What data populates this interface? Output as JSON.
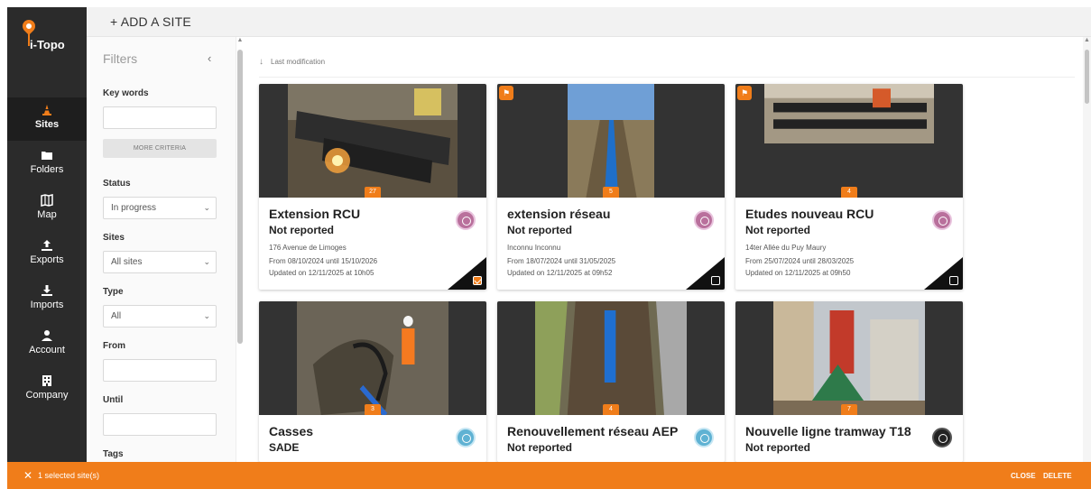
{
  "app": {
    "logo_text": "i-Topo"
  },
  "nav": [
    {
      "label": "Sites",
      "icon": "cone-icon",
      "active": true
    },
    {
      "label": "Folders",
      "icon": "folder-icon"
    },
    {
      "label": "Map",
      "icon": "map-icon"
    },
    {
      "label": "Exports",
      "icon": "upload-icon"
    },
    {
      "label": "Imports",
      "icon": "download-icon"
    },
    {
      "label": "Account",
      "icon": "user-icon"
    },
    {
      "label": "Company",
      "icon": "building-icon"
    }
  ],
  "topbar": {
    "add_site": "+ ADD A SITE"
  },
  "filters": {
    "title": "Filters",
    "keywords_label": "Key words",
    "keywords_value": "",
    "more_criteria": "MORE CRITERIA",
    "status_label": "Status",
    "status_value": "In progress",
    "sites_label": "Sites",
    "sites_value": "All sites",
    "type_label": "Type",
    "type_value": "All",
    "from_label": "From",
    "until_label": "Until",
    "tags_label": "Tags"
  },
  "sort": {
    "label": "Last modification"
  },
  "cards": [
    {
      "title": "Extension RCU",
      "status": "Not reported",
      "address": "176 Avenue de Limoges",
      "dates": "From 08/10/2024  until 15/10/2026",
      "updated": "Updated on 12/11/2025 at 10h05",
      "count": "27",
      "badge_color": "purple",
      "selected": true,
      "flag": false
    },
    {
      "title": "extension réseau",
      "status": "Not reported",
      "address": "Inconnu Inconnu",
      "dates": "From 18/07/2024  until 31/05/2025",
      "updated": "Updated on 12/11/2025 at 09h52",
      "count": "5",
      "badge_color": "purple",
      "selected": false,
      "flag": true
    },
    {
      "title": "Etudes nouveau RCU",
      "status": "Not reported",
      "address": "14ter Allée du Puy Maury",
      "dates": "From 25/07/2024  until 28/03/2025",
      "updated": "Updated on 12/11/2025 at 09h50",
      "count": "4",
      "badge_color": "purple",
      "selected": false,
      "flag": true
    },
    {
      "title": "Casses",
      "status": "SADE",
      "count": "3",
      "badge_color": "blue"
    },
    {
      "title": "Renouvellement réseau AEP",
      "status": "Not reported",
      "count": "4",
      "badge_color": "blue"
    },
    {
      "title": "Nouvelle ligne tramway T18",
      "status": "Not reported",
      "count": "7",
      "badge_color": "black"
    }
  ],
  "bottombar": {
    "selected_text": "1 selected site(s)",
    "close": "CLOSE",
    "delete": "DELETE"
  },
  "colors": {
    "accent": "#f07d1a",
    "nav_bg": "#2b2b2b"
  }
}
